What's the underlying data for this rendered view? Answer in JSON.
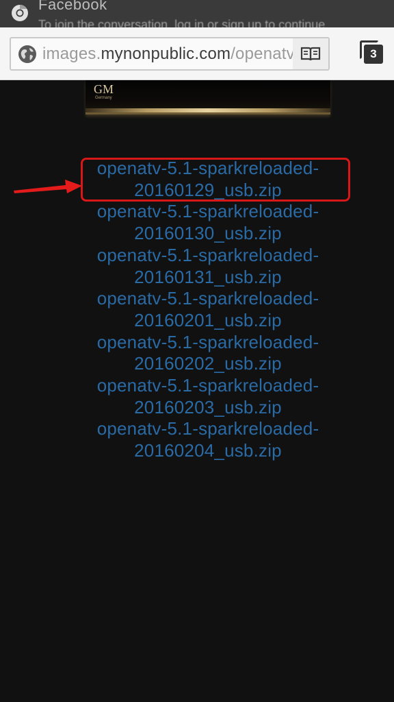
{
  "notification": {
    "title": "Facebook",
    "subtitle": "To join the conversation, log in or sign up to continue"
  },
  "toolbar": {
    "url_prefix": "images.",
    "url_domain": "mynonpublic.com",
    "url_path": "/openatv/",
    "tab_count": "3"
  },
  "product_image": {
    "brand": "GM",
    "brand_sub": "Germany"
  },
  "links": [
    {
      "line1": "openatv-5.1-sparkreloaded-",
      "line2": "20160129_usb.zip"
    },
    {
      "line1": "openatv-5.1-sparkreloaded-",
      "line2": "20160130_usb.zip"
    },
    {
      "line1": "openatv-5.1-sparkreloaded-",
      "line2": "20160131_usb.zip"
    },
    {
      "line1": "openatv-5.1-sparkreloaded-",
      "line2": "20160201_usb.zip"
    },
    {
      "line1": "openatv-5.1-sparkreloaded-",
      "line2": "20160202_usb.zip"
    },
    {
      "line1": "openatv-5.1-sparkreloaded-",
      "line2": "20160203_usb.zip"
    },
    {
      "line1": "openatv-5.1-sparkreloaded-",
      "line2": "20160204_usb.zip"
    }
  ],
  "colors": {
    "link": "#2a6aa5",
    "highlight": "#d81818",
    "background": "#111111"
  }
}
